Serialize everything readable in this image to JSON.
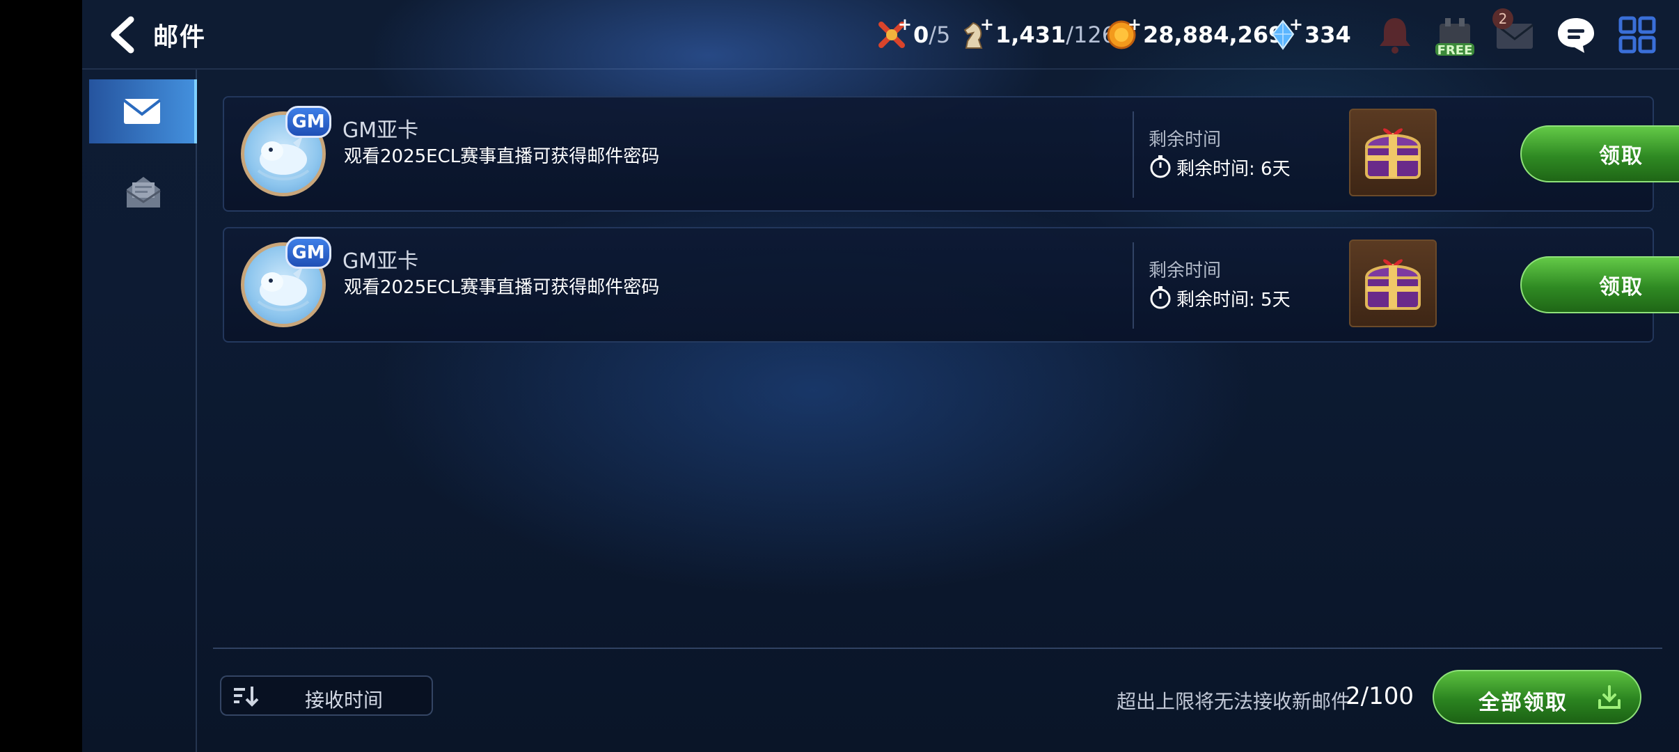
{
  "header": {
    "title": "邮件",
    "resources": {
      "stamina": {
        "value": "0",
        "max": "/5"
      },
      "knight": {
        "value": "1,431",
        "max": "/126"
      },
      "gold": {
        "value": "28,884,269"
      },
      "gem": {
        "value": "334"
      }
    },
    "icons": {
      "bell": "bell-icon",
      "shop_free_label": "FREE",
      "mail_badge": "2",
      "chat": "chat-icon",
      "menu": "grid-menu-icon"
    }
  },
  "sidebar": {
    "tabs": [
      {
        "name": "inbox",
        "icon": "mail-icon",
        "active": true
      },
      {
        "name": "read",
        "icon": "opened-mail-icon",
        "active": false
      }
    ]
  },
  "mails": [
    {
      "badge": "GM",
      "sender": "GM亚卡",
      "subject": "观看2025ECL赛事直播可获得邮件密码",
      "remain_label": "剩余时间",
      "remain_text": "剩余时间: 6天",
      "claim_label": "领取"
    },
    {
      "badge": "GM",
      "sender": "GM亚卡",
      "subject": "观看2025ECL赛事直播可获得邮件密码",
      "remain_label": "剩余时间",
      "remain_text": "剩余时间: 5天",
      "claim_label": "领取"
    }
  ],
  "footer": {
    "sort_label": "接收时间",
    "limit_text": "超出上限将无法接收新邮件",
    "count": "2/100",
    "claim_all_label": "全部领取"
  },
  "colors": {
    "accent_green": "#2f8a23",
    "tab_active": "#3b8fe0",
    "background": "#0d1b33"
  }
}
